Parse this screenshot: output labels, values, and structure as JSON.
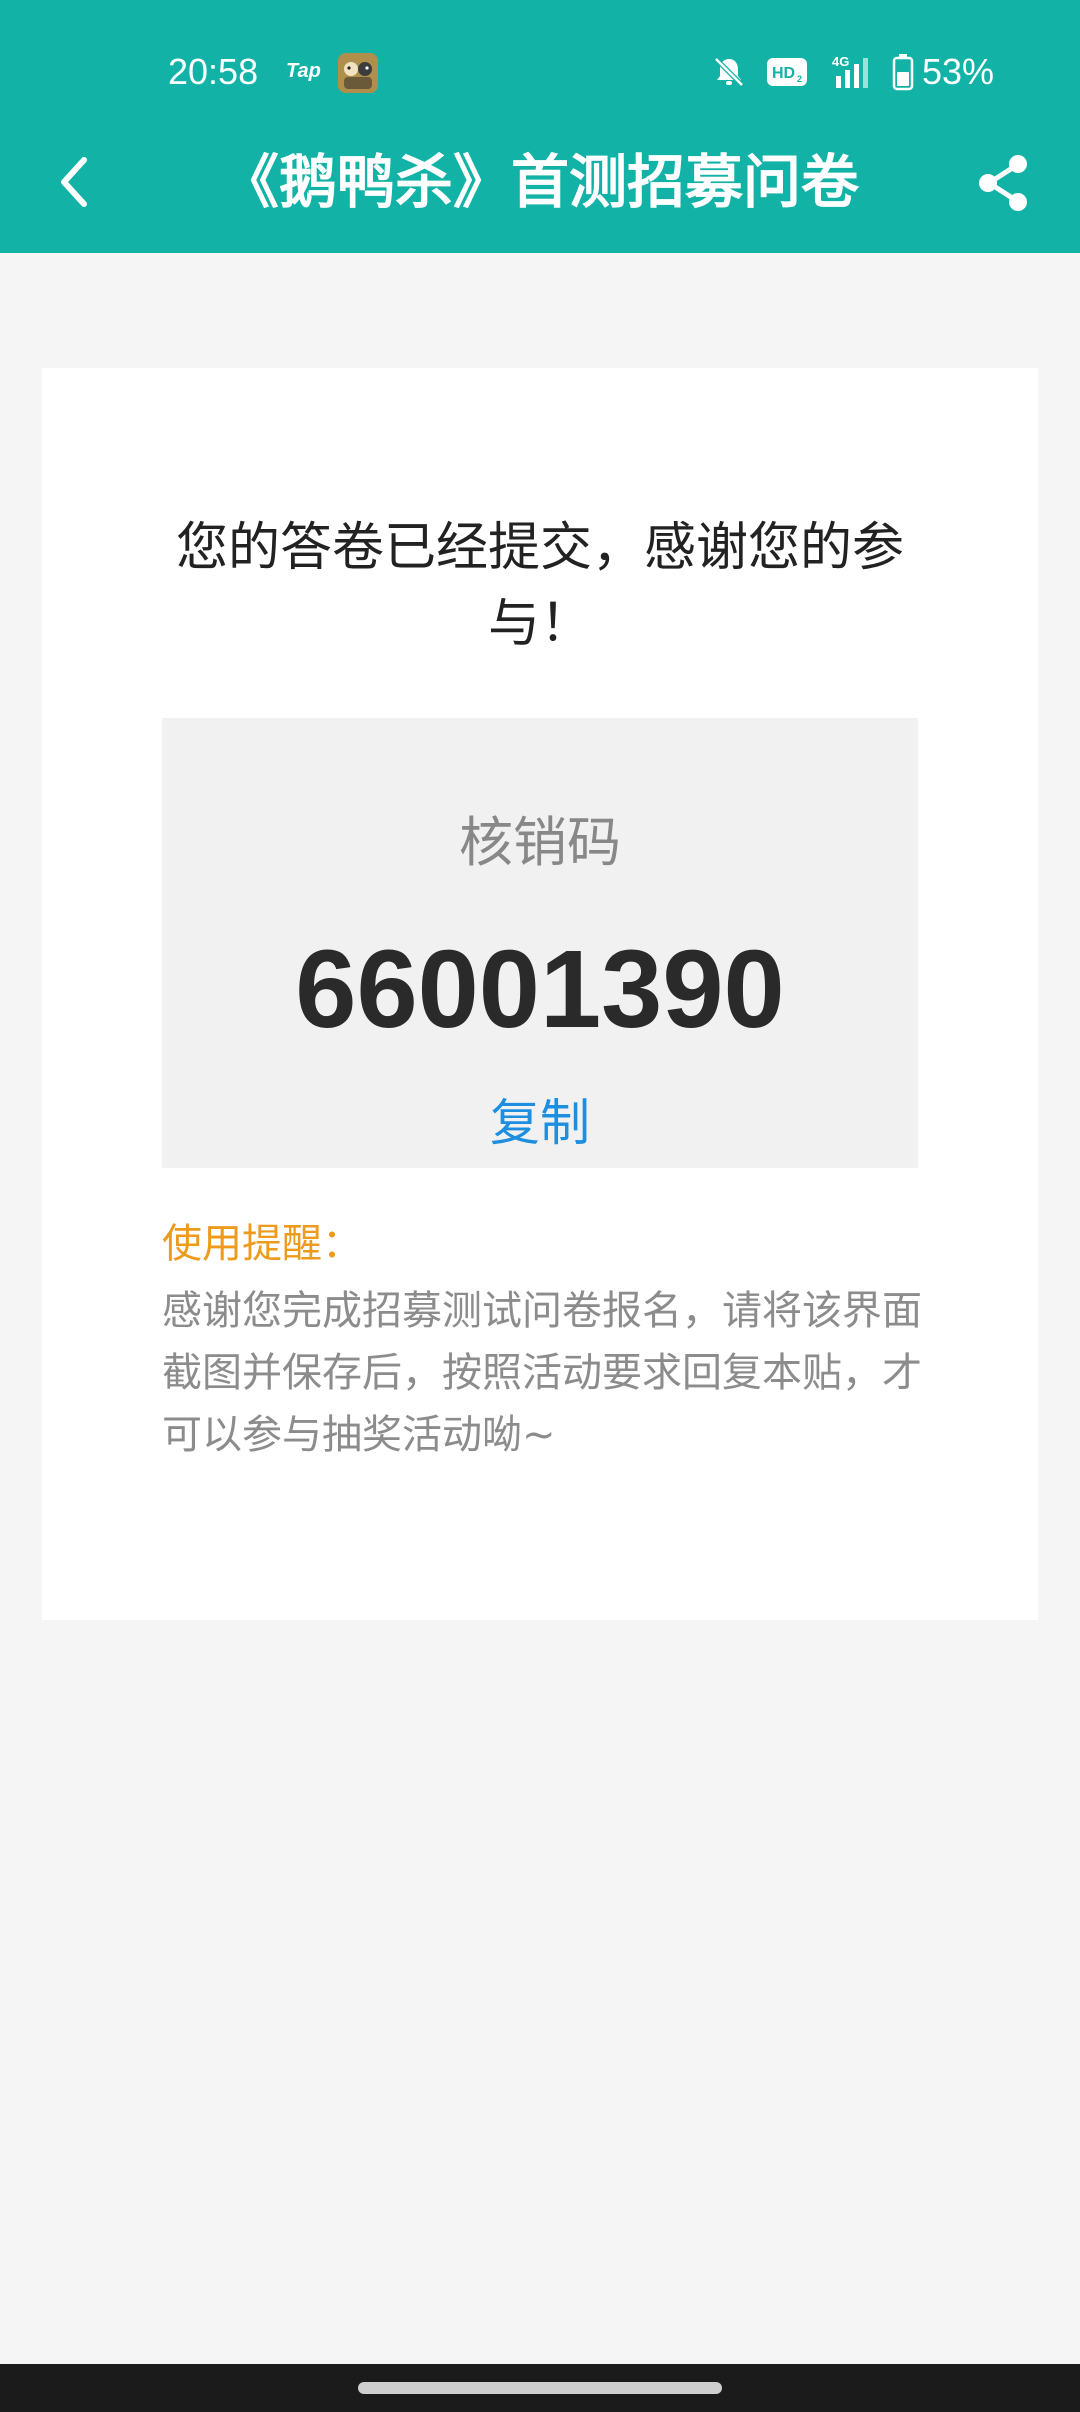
{
  "status_bar": {
    "time": "20:58",
    "tap_badge": "Tap",
    "battery_percent": "53%",
    "icons": [
      "tap-notification-icon",
      "game-app-icon",
      "mute-icon",
      "hd-voice-icon",
      "signal-4g-icon",
      "battery-icon"
    ]
  },
  "header": {
    "title": "《鹅鸭杀》首测招募问卷",
    "back_icon": "chevron-left-icon",
    "share_icon": "share-icon"
  },
  "card": {
    "success_message": "您的答卷已经提交，感谢您的参与！",
    "code_label": "核销码",
    "code_value": "66001390",
    "copy_label": "复制",
    "reminder_title": "使用提醒：",
    "reminder_text": "感谢您完成招募测试问卷报名，请将该界面截图并保存后，按照活动要求回复本贴，才可以参与抽奖活动呦~"
  },
  "colors": {
    "header_bg": "#12b2a6",
    "page_bg": "#f5f5f5",
    "code_box_bg": "#f1f1f1",
    "copy_link": "#1e8fe0",
    "reminder_title": "#ee9a1c",
    "reminder_text": "#8c8c8c"
  }
}
